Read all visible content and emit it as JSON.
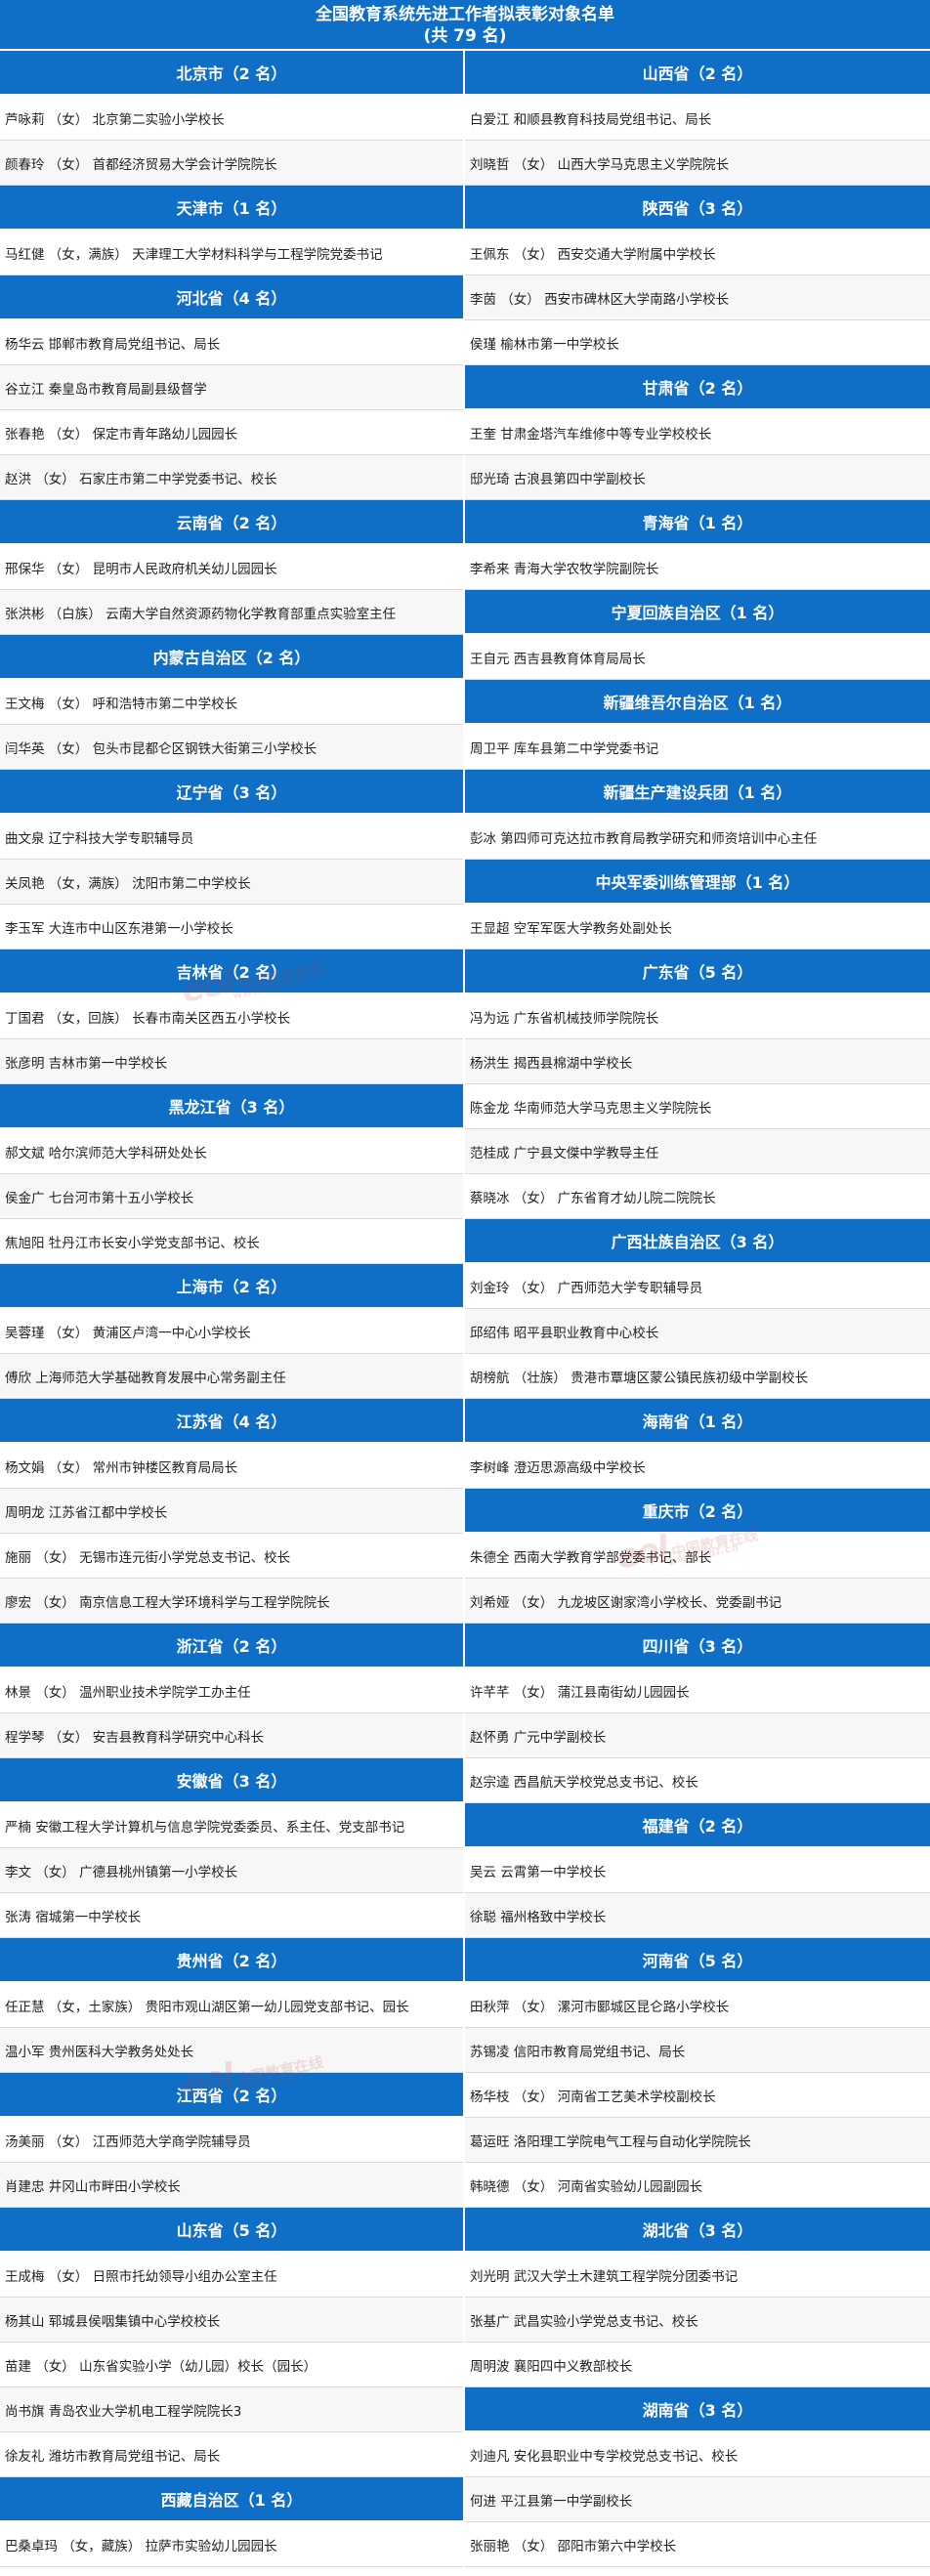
{
  "title": {
    "line1": "全国教育系统先进工作者拟表彰对象名单",
    "line2": "(共 79 名)"
  },
  "watermark": {
    "logo": "eol",
    "text": "中国教育在线",
    "url": "www.eol.cn"
  },
  "left": [
    {
      "type": "header",
      "text": "北京市（2 名）"
    },
    {
      "type": "person",
      "text": "芦咏莉 （女） 北京第二实验小学校长"
    },
    {
      "type": "person",
      "text": "颜春玲 （女） 首都经济贸易大学会计学院院长"
    },
    {
      "type": "header",
      "text": "天津市（1 名）"
    },
    {
      "type": "person",
      "text": "马红健 （女，满族） 天津理工大学材料科学与工程学院党委书记"
    },
    {
      "type": "header",
      "text": "河北省（4 名）"
    },
    {
      "type": "person",
      "text": "杨华云  邯郸市教育局党组书记、局长"
    },
    {
      "type": "person",
      "text": "谷立江  秦皇岛市教育局副县级督学"
    },
    {
      "type": "person",
      "text": "张春艳 （女） 保定市青年路幼儿园园长"
    },
    {
      "type": "person",
      "text": "赵洪 （女） 石家庄市第二中学党委书记、校长"
    },
    {
      "type": "header",
      "text": "云南省（2 名）"
    },
    {
      "type": "person",
      "text": "邢保华 （女） 昆明市人民政府机关幼儿园园长"
    },
    {
      "type": "person",
      "text": "张洪彬 （白族） 云南大学自然资源药物化学教育部重点实验室主任"
    },
    {
      "type": "header",
      "text": "内蒙古自治区（2 名）"
    },
    {
      "type": "person",
      "text": "王文梅 （女） 呼和浩特市第二中学校长"
    },
    {
      "type": "person",
      "text": "闫华英 （女） 包头市昆都仑区钢铁大街第三小学校长"
    },
    {
      "type": "header",
      "text": "辽宁省（3 名）"
    },
    {
      "type": "person",
      "text": "曲文泉  辽宁科技大学专职辅导员"
    },
    {
      "type": "person",
      "text": "关凤艳 （女，满族） 沈阳市第二中学校长"
    },
    {
      "type": "person",
      "text": "李玉军  大连市中山区东港第一小学校长"
    },
    {
      "type": "header",
      "text": "吉林省（2 名）"
    },
    {
      "type": "person",
      "text": "丁国君 （女，回族） 长春市南关区西五小学校长"
    },
    {
      "type": "person",
      "text": "张彦明  吉林市第一中学校长"
    },
    {
      "type": "header",
      "text": "黑龙江省（3 名）"
    },
    {
      "type": "person",
      "text": "郝文斌  哈尔滨师范大学科研处处长"
    },
    {
      "type": "person",
      "text": "侯金广  七台河市第十五小学校长"
    },
    {
      "type": "person",
      "text": "焦旭阳  牡丹江市长安小学党支部书记、校长"
    },
    {
      "type": "header",
      "text": "上海市（2 名）"
    },
    {
      "type": "person",
      "text": "吴蓉瑾 （女） 黄浦区卢湾一中心小学校长"
    },
    {
      "type": "person",
      "text": "傅欣  上海师范大学基础教育发展中心常务副主任"
    },
    {
      "type": "header",
      "text": "江苏省（4 名）"
    },
    {
      "type": "person",
      "text": "杨文娟 （女） 常州市钟楼区教育局局长"
    },
    {
      "type": "person",
      "text": "周明龙  江苏省江都中学校长"
    },
    {
      "type": "person",
      "text": "施丽 （女） 无锡市连元街小学党总支书记、校长"
    },
    {
      "type": "person",
      "text": "廖宏 （女） 南京信息工程大学环境科学与工程学院院长"
    },
    {
      "type": "header",
      "text": "浙江省（2 名）"
    },
    {
      "type": "person",
      "text": "林景 （女） 温州职业技术学院学工办主任"
    },
    {
      "type": "person",
      "text": "程学琴 （女） 安吉县教育科学研究中心科长"
    },
    {
      "type": "header",
      "text": "安徽省（3 名）"
    },
    {
      "type": "person",
      "text": "严楠  安徽工程大学计算机与信息学院党委委员、系主任、党支部书记"
    },
    {
      "type": "person",
      "text": "李文 （女） 广德县桃州镇第一小学校长"
    },
    {
      "type": "person",
      "text": "张涛  宿城第一中学校长"
    },
    {
      "type": "header",
      "text": "贵州省（2 名）"
    },
    {
      "type": "person",
      "text": "任正慧 （女，土家族） 贵阳市观山湖区第一幼儿园党支部书记、园长"
    },
    {
      "type": "person",
      "text": "温小军  贵州医科大学教务处处长"
    },
    {
      "type": "header",
      "text": "江西省（2 名）"
    },
    {
      "type": "person",
      "text": "汤美丽 （女） 江西师范大学商学院辅导员"
    },
    {
      "type": "person",
      "text": "肖建忠  井冈山市畔田小学校长"
    },
    {
      "type": "header",
      "text": "山东省（5 名）"
    },
    {
      "type": "person",
      "text": "王成梅 （女） 日照市托幼领导小组办公室主任"
    },
    {
      "type": "person",
      "text": "杨其山  郓城县侯咽集镇中心学校校长"
    },
    {
      "type": "person",
      "text": "苗建 （女） 山东省实验小学（幼儿园）校长（园长）"
    },
    {
      "type": "person",
      "text": "尚书旗  青岛农业大学机电工程学院院长3"
    },
    {
      "type": "person",
      "text": "徐友礼  潍坊市教育局党组书记、局长"
    },
    {
      "type": "header",
      "text": "西藏自治区（1 名）"
    },
    {
      "type": "person",
      "text": "巴桑卓玛 （女，藏族） 拉萨市实验幼儿园园长"
    }
  ],
  "right": [
    {
      "type": "header",
      "text": "山西省（2 名）"
    },
    {
      "type": "person",
      "text": "白爱江  和顺县教育科技局党组书记、局长"
    },
    {
      "type": "person",
      "text": "刘晓哲 （女） 山西大学马克思主义学院院长"
    },
    {
      "type": "header",
      "text": "陕西省（3 名）"
    },
    {
      "type": "person",
      "text": "王佩东 （女） 西安交通大学附属中学校长"
    },
    {
      "type": "person",
      "text": "李茵 （女） 西安市碑林区大学南路小学校长"
    },
    {
      "type": "person",
      "text": "侯瑾  榆林市第一中学校长"
    },
    {
      "type": "header",
      "text": "甘肃省（2 名）"
    },
    {
      "type": "person",
      "text": "王奎  甘肃金塔汽车维修中等专业学校校长"
    },
    {
      "type": "person",
      "text": "邸光琦  古浪县第四中学副校长"
    },
    {
      "type": "header",
      "text": "青海省（1 名）"
    },
    {
      "type": "person",
      "text": "李希来  青海大学农牧学院副院长"
    },
    {
      "type": "header",
      "text": "宁夏回族自治区（1 名）"
    },
    {
      "type": "person",
      "text": "王自元  西吉县教育体育局局长"
    },
    {
      "type": "header",
      "text": "新疆维吾尔自治区（1 名）"
    },
    {
      "type": "person",
      "text": "周卫平  库车县第二中学党委书记"
    },
    {
      "type": "header",
      "text": "新疆生产建设兵团（1 名）"
    },
    {
      "type": "person",
      "text": "彭冰  第四师可克达拉市教育局教学研究和师资培训中心主任"
    },
    {
      "type": "header",
      "text": "中央军委训练管理部（1 名）"
    },
    {
      "type": "person",
      "text": "王显超  空军军医大学教务处副处长"
    },
    {
      "type": "header",
      "text": "广东省（5 名）"
    },
    {
      "type": "person",
      "text": "冯为远  广东省机械技师学院院长"
    },
    {
      "type": "person",
      "text": "杨洪生  揭西县棉湖中学校长"
    },
    {
      "type": "person",
      "text": "陈金龙  华南师范大学马克思主义学院院长"
    },
    {
      "type": "person",
      "text": "范桂成  广宁县文傑中学教导主任"
    },
    {
      "type": "person",
      "text": "蔡晓冰 （女） 广东省育才幼儿院二院院长"
    },
    {
      "type": "header",
      "text": "广西壮族自治区（3 名）"
    },
    {
      "type": "person",
      "text": "刘金玲 （女） 广西师范大学专职辅导员"
    },
    {
      "type": "person",
      "text": "邱绍伟  昭平县职业教育中心校长"
    },
    {
      "type": "person",
      "text": "胡榜航 （壮族） 贵港市覃塘区蒙公镇民族初级中学副校长"
    },
    {
      "type": "header",
      "text": "海南省（1 名）"
    },
    {
      "type": "person",
      "text": "李树峰  澄迈思源高级中学校长"
    },
    {
      "type": "header",
      "text": "重庆市（2 名）"
    },
    {
      "type": "person",
      "text": "朱德全  西南大学教育学部党委书记、部长"
    },
    {
      "type": "person",
      "text": "刘希娅 （女） 九龙坡区谢家湾小学校长、党委副书记"
    },
    {
      "type": "header",
      "text": "四川省（3 名）"
    },
    {
      "type": "person",
      "text": "许芊芊 （女） 蒲江县南街幼儿园园长"
    },
    {
      "type": "person",
      "text": "赵怀勇  广元中学副校长"
    },
    {
      "type": "person",
      "text": "赵宗逵  西昌航天学校党总支书记、校长"
    },
    {
      "type": "header",
      "text": "福建省（2 名）"
    },
    {
      "type": "person",
      "text": "吴云  云霄第一中学校长"
    },
    {
      "type": "person",
      "text": "徐聪  福州格致中学校长"
    },
    {
      "type": "header",
      "text": "河南省（5 名）"
    },
    {
      "type": "person",
      "text": "田秋萍 （女） 漯河市郾城区昆仑路小学校长"
    },
    {
      "type": "person",
      "text": "苏锡凌  信阳市教育局党组书记、局长"
    },
    {
      "type": "person",
      "text": "杨华枝 （女） 河南省工艺美术学校副校长"
    },
    {
      "type": "person",
      "text": "葛运旺  洛阳理工学院电气工程与自动化学院院长"
    },
    {
      "type": "person",
      "text": "韩晓德 （女） 河南省实验幼儿园副园长"
    },
    {
      "type": "header",
      "text": "湖北省（3 名）"
    },
    {
      "type": "person",
      "text": "刘光明  武汉大学土木建筑工程学院分团委书记"
    },
    {
      "type": "person",
      "text": "张基广  武昌实验小学党总支书记、校长"
    },
    {
      "type": "person",
      "text": "周明波  襄阳四中义教部校长"
    },
    {
      "type": "header",
      "text": "湖南省（3 名）"
    },
    {
      "type": "person",
      "text": "刘迪凡  安化县职业中专学校党总支书记、校长"
    },
    {
      "type": "person",
      "text": "何进  平江县第一中学副校长"
    },
    {
      "type": "person",
      "text": "张丽艳 （女） 邵阳市第六中学校长"
    }
  ]
}
